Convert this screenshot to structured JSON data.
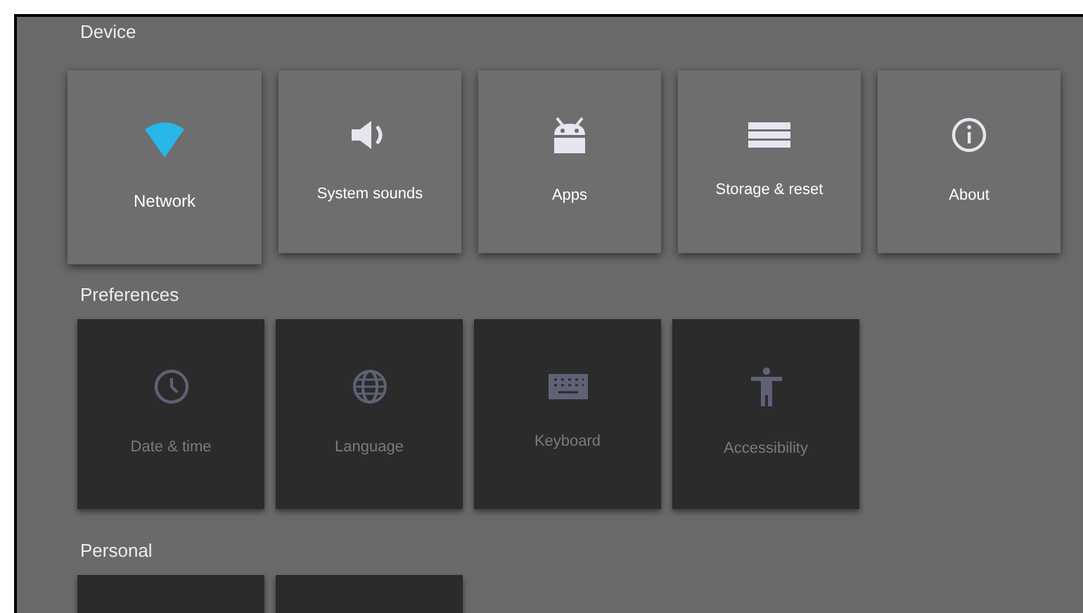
{
  "sections": [
    {
      "title": "Device",
      "enabled": true,
      "tiles": [
        {
          "label": "Network",
          "kind": "wifi",
          "selected": true
        },
        {
          "label": "System sounds",
          "kind": "speaker",
          "selected": false
        },
        {
          "label": "Apps",
          "kind": "android",
          "selected": false
        },
        {
          "label": "Storage & reset",
          "kind": "storage",
          "selected": false
        },
        {
          "label": "About",
          "kind": "info",
          "selected": false
        }
      ]
    },
    {
      "title": "Preferences",
      "enabled": false,
      "tiles": [
        {
          "label": "Date & time",
          "kind": "clock",
          "selected": false
        },
        {
          "label": "Language",
          "kind": "globe",
          "selected": false
        },
        {
          "label": "Keyboard",
          "kind": "keyboard",
          "selected": false
        },
        {
          "label": "Accessibility",
          "kind": "accessibility",
          "selected": false
        }
      ]
    },
    {
      "title": "Personal",
      "enabled": false,
      "tiles": [
        {
          "kind": "blank",
          "selected": false
        },
        {
          "kind": "blank",
          "selected": false
        }
      ]
    }
  ]
}
